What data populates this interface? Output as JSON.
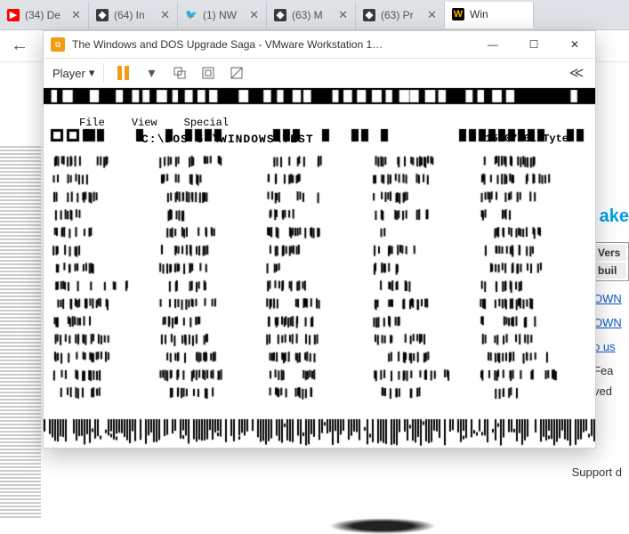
{
  "browser": {
    "tabs": [
      {
        "icon": "youtube",
        "label": "(34) De"
      },
      {
        "icon": "roblox",
        "label": "(64) In"
      },
      {
        "icon": "twitter",
        "label": "(1) NW"
      },
      {
        "icon": "roblox",
        "label": "(63) M"
      },
      {
        "icon": "roblox",
        "label": "(63) Pr"
      },
      {
        "icon": "winworld",
        "label": "Win"
      }
    ],
    "back_label": "←"
  },
  "vmware": {
    "title": "The Windows and DOS Upgrade Saga - VMware Workstation 1…",
    "player_label": "Player",
    "min": "—",
    "max": "☐",
    "close": "✕",
    "collapse": "≪"
  },
  "dos": {
    "menu": [
      "File",
      "View",
      "Special"
    ],
    "path": "C:\\DOS 5 \\WINDOWS\\TEST",
    "time": "15:07 01 Tyte",
    "file_cols": [
      [
        "ARROW.CUR",
        "SIZEWE",
        "PEN.CUR",
        "CROSS",
        "WAIT.CUR",
        "IBEAM",
        "SIZENS",
        "COUNTER.EXE",
        "ARROW.CUR",
        "NO.CUR",
        "APPSTART",
        "HELP.CUR",
        "SIZEALL",
        "UPARROW"
      ],
      [
        "ARROW.CUR",
        "SIZENS",
        "PEN.CUR",
        "HELP",
        "SIZENWSE",
        "SIZEALL",
        "BEAM.CUR",
        "MOVE.CUR",
        "SIZENESW",
        "NO.CUR",
        "UPARROW",
        "SIZE.CUR",
        "CROSS.CUR",
        "WAIT.EXE"
      ],
      [
        "BUSY.CUR",
        "CROSS",
        "HELP.CUR",
        "BEAM",
        "WAIT.CUR",
        "ARROW",
        "NO",
        "SIZEWE",
        "MOVE.CUR",
        "PEN.CUR",
        "SIZE.CUR",
        "APPSTART",
        "UPARROW",
        "COUNTER"
      ],
      [
        "ARROW.EXE",
        "SIZENESW",
        "CROSS",
        "HELP.CUR",
        "PEN",
        "SIZEWE",
        "MOVE",
        "NO.CUR",
        "SIZENWSE",
        "WAIT",
        "BEAM.CUR",
        "APPSTART",
        "UPARROW.CUR",
        "SIZEALL"
      ],
      [
        "CURS.RES",
        "SIZENS.RES",
        "HELP.RES",
        "PEN.RES",
        "CROSS.RES",
        "BUSY.RES",
        "ARROW.RES",
        "NO.RES",
        "WAIT.RES",
        "BEAM.RES",
        "MOVE.RES",
        "SIZEWE.RES",
        "UPARROW.RES",
        "SIZE.RES"
      ]
    ]
  },
  "page": {
    "akeo": "ake",
    "vers_hdr": "Vers",
    "build_hdr": "buil",
    "link1": "OWN",
    "link2": "OWN",
    "link3": "o us",
    "fea": "Fea",
    "ved": "ved",
    "support": "Support d"
  }
}
